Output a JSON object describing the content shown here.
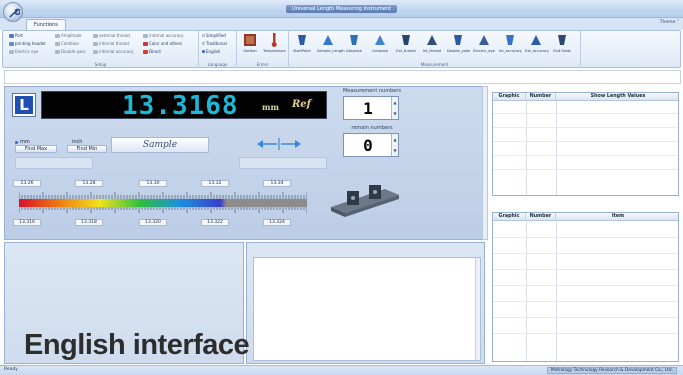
{
  "window": {
    "title": "Universal Length Measuring Instrument"
  },
  "ribbon": {
    "tab": "Functions",
    "theme": "Theme ˅",
    "setup": {
      "caption": "Setup",
      "items": [
        "Port",
        "printing header",
        "Electric eye",
        "Amplitude",
        "Combine",
        "Double pass",
        "external thread",
        "internal thread",
        "internal accuracy",
        "internal accuracy",
        "Color and others",
        "Direct"
      ]
    },
    "language": {
      "caption": "Language",
      "items": [
        "Simplified",
        "Traditional",
        "English"
      ]
    },
    "errors": {
      "caption": "Errors",
      "buttons": [
        "Section",
        "Temperature"
      ]
    },
    "measurement": {
      "caption": "Measurement",
      "buttons": [
        "StartPoint",
        "Sample_Length",
        "Absolute",
        "Compare",
        "Ext_thread",
        "Int_thread",
        "Double_yoke",
        "Electric_eye",
        "Int_accuracy",
        "Ext_accuracy",
        "Exit\nFolds"
      ]
    }
  },
  "display": {
    "mode_letter": "L",
    "value": "13.3168",
    "unit": "mm",
    "ref": "Ref",
    "measurement_numbers_label": "Measurement numbers",
    "measurement_number": "1",
    "remain_numbers_label": "remain numbers",
    "remain_number": "0"
  },
  "controls": {
    "mm": "mm",
    "inch": "inch",
    "find_max": "Find Max",
    "find_min": "Find Min",
    "sample": "Sample"
  },
  "ruler": {
    "top_labels": [
      "13.26",
      "13.28",
      "13.30",
      "13.32",
      "13.34"
    ],
    "bottom_labels": [
      "13.316",
      "13.318",
      "13.320",
      "13.322",
      "13.324"
    ]
  },
  "table_top": {
    "headers": [
      "Graphic",
      "Number",
      "Show Length Values"
    ]
  },
  "table_bottom": {
    "headers": [
      "Graphic",
      "Number",
      "Item"
    ]
  },
  "caption": "English interface",
  "status": {
    "left": "Ready",
    "right": "Metrology Technology Research & Development Co., Ltd."
  },
  "colors": {
    "display_digits": "#1fb7d6",
    "unit_box": "#1f4fb1",
    "ribbon_bg": "#dfe9f6"
  }
}
